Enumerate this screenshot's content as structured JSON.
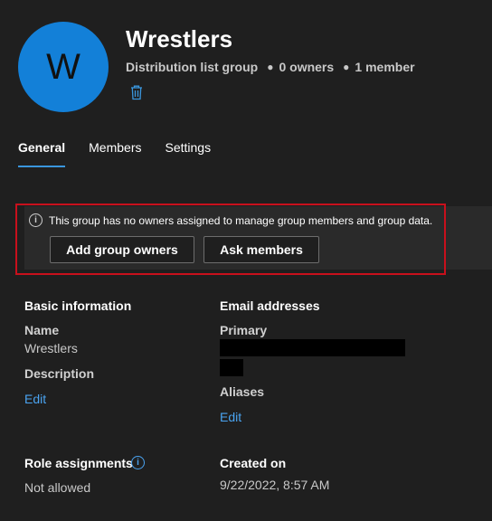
{
  "group": {
    "avatar_letter": "W",
    "name": "Wrestlers",
    "type": "Distribution list group",
    "owners": "0 owners",
    "members": "1 member"
  },
  "tabs": [
    {
      "label": "General",
      "active": true
    },
    {
      "label": "Members",
      "active": false
    },
    {
      "label": "Settings",
      "active": false
    }
  ],
  "banner": {
    "message": "This group has no owners assigned to manage group members and group data.",
    "add_owners_label": "Add group owners",
    "ask_members_label": "Ask members"
  },
  "basic_info": {
    "heading": "Basic information",
    "name_label": "Name",
    "name_value": "Wrestlers",
    "description_label": "Description",
    "edit_label": "Edit"
  },
  "email": {
    "heading": "Email addresses",
    "primary_label": "Primary",
    "aliases_label": "Aliases",
    "edit_label": "Edit"
  },
  "roles": {
    "heading": "Role assignments",
    "value": "Not allowed"
  },
  "created": {
    "heading": "Created on",
    "value": "9/22/2022, 8:57 AM"
  },
  "colors": {
    "accent": "#1380d8",
    "link": "#4aa3f0",
    "highlight_border": "#c8101c",
    "background": "#1f1f1f"
  }
}
